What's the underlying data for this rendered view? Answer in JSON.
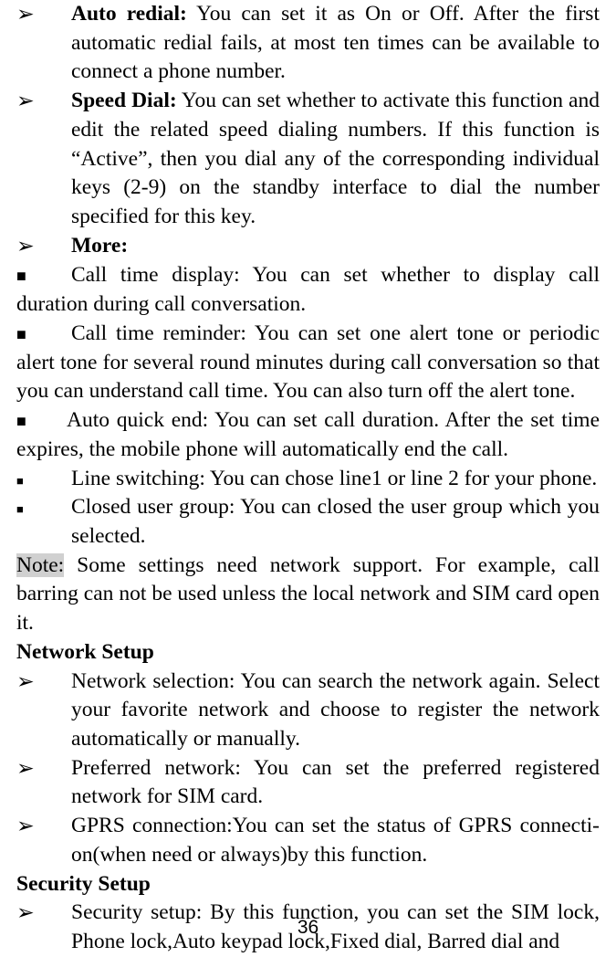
{
  "items": {
    "auto_redial_label": "Auto redial:",
    "auto_redial_text": " You can set it as On or Off. After the first automatic redial fails, at most ten times can be available to connect a phone number.",
    "speed_dial_label": "Speed Dial:",
    "speed_dial_text": " You can set whether to activate this function and edit the related speed dialing numbers. If this function is “Active”, then you dial any of the corresponding individual keys (2-9) on the standby interface to dial the number specified for this key.",
    "more_label": "More:",
    "call_time_display": "Call time display: You can set whether to display call duration during call conversation.",
    "call_time_reminder": "Call time reminder: You can set one alert tone or periodic alert tone for several round minutes during call conversation so that you can understand call time. You can also turn off the alert tone.",
    "auto_quick_end": "Auto quick end: You can set call duration. After the set time expires, the mobile phone will automatically end the call.",
    "line_switching": "Line switching: You can chose line1 or line 2 for your phone.",
    "closed_user_group": "Closed user group: You can closed the user group which you selected.",
    "note_label": "Note:",
    "note_text": " Some settings need network support. For example, call barring can not be used unless the local network and SIM card open it.",
    "network_setup_heading": "Network Setup",
    "network_selection": "Network selection: You can search the network again. Select your favorite network and choose to register the network automatically or manually.",
    "preferred_network": "Preferred network: You can set the preferred registered network for SIM card.",
    "gprs_connection": "GPRS  connection:You  can  set  the  status  of  GPRS  connecti- on(when  need  or  always)by  this  function.",
    "security_setup_heading": "Security Setup",
    "security_setup": "Security setup: By this function, you can set the SIM lock, Phone lock,Auto keypad lock,Fixed dial, Barred dial and"
  },
  "bullets": {
    "arrow": "➢",
    "square_filled": "■"
  },
  "page_number": "36"
}
